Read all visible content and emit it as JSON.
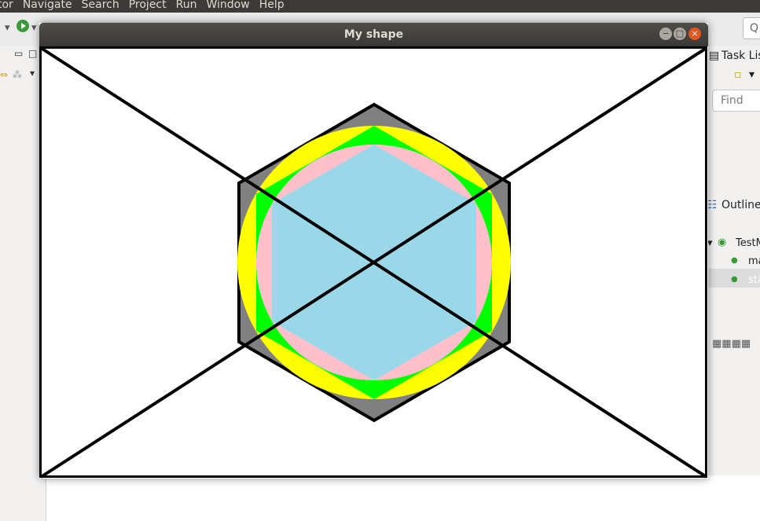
{
  "menubar": {
    "items": [
      "tor",
      "Navigate",
      "Search",
      "Project",
      "Run",
      "Window",
      "Help"
    ]
  },
  "toolbar": {
    "quick_access": "Q"
  },
  "right_panel": {
    "task_list_title": "Task Lis",
    "find_placeholder": "Find",
    "outline_title": "Outline",
    "outline_items": [
      "TestM",
      "ma",
      "sta"
    ]
  },
  "window": {
    "title": "My shape",
    "controls": {
      "minimize": "−",
      "maximize": "□",
      "close": "×"
    }
  },
  "colors": {
    "hexagon_outer": "#808080",
    "circle": "#ffff00",
    "hexagon_green": "#00ff00",
    "hexagon_pink": "#ffc0cb",
    "hexagon_inner": "#9ad8e9",
    "stroke": "#000000"
  }
}
